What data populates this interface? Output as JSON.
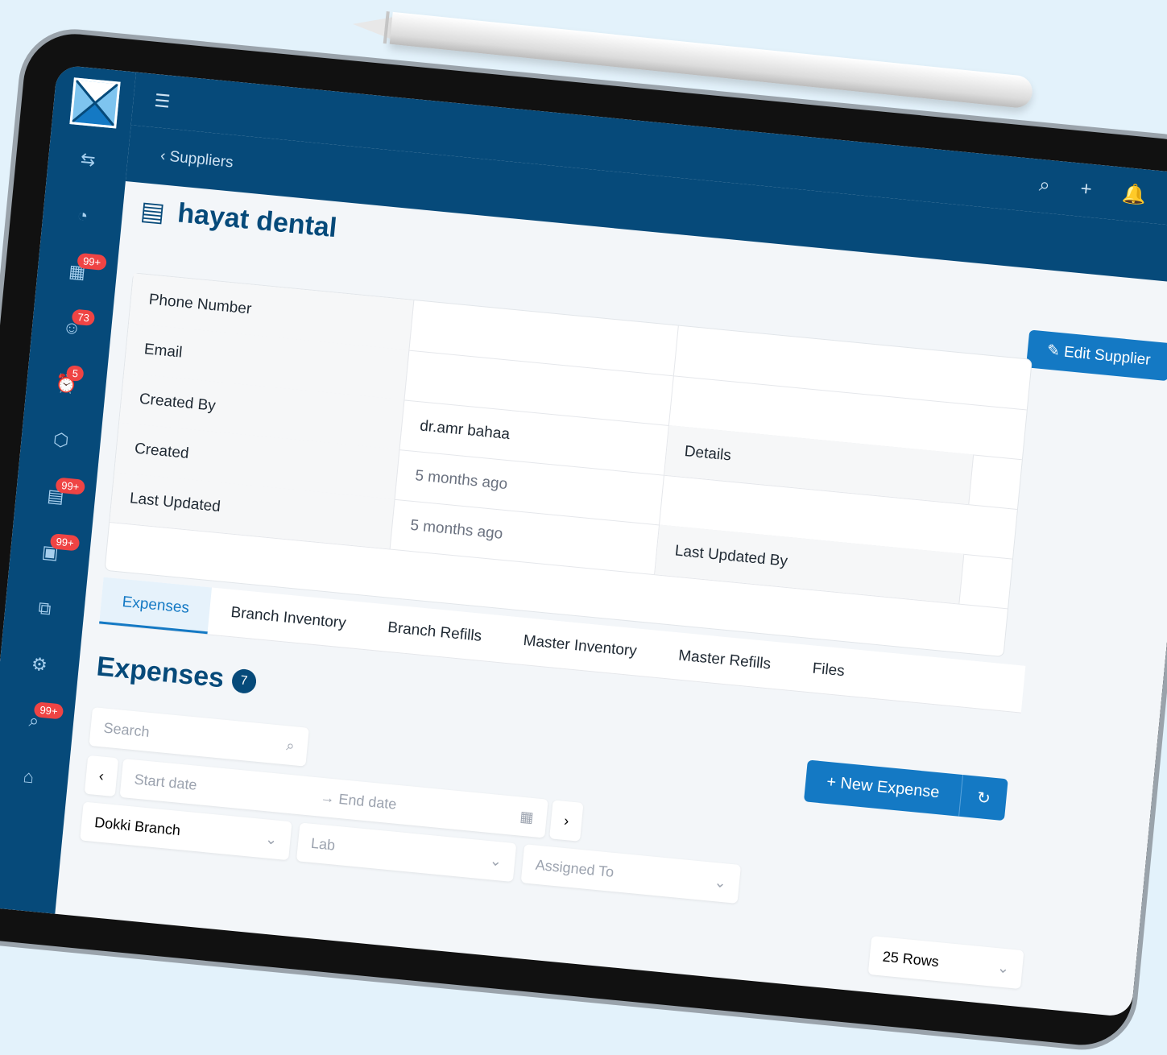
{
  "sidebar": {
    "items": [
      {
        "icon": "swap-icon"
      },
      {
        "icon": "dashboard-icon"
      },
      {
        "icon": "appointments-icon",
        "badge": "99+"
      },
      {
        "icon": "patients-icon",
        "badge": "73"
      },
      {
        "icon": "alarm-icon",
        "badge": "5"
      },
      {
        "icon": "inventory-icon"
      },
      {
        "icon": "invoice-icon",
        "badge": "99+"
      },
      {
        "icon": "payments-icon",
        "badge": "99+"
      },
      {
        "icon": "branches-icon"
      },
      {
        "icon": "settings-icon"
      },
      {
        "icon": "reports-icon",
        "badge": "99+"
      },
      {
        "icon": "bank-icon"
      }
    ]
  },
  "breadcrumb": {
    "back_label": "Suppliers"
  },
  "page": {
    "title": "hayat dental"
  },
  "edit_button": "Edit Supplier",
  "info": {
    "phone_label": "Phone Number",
    "email_label": "Email",
    "created_by_label": "Created By",
    "created_by_value": "dr.amr bahaa",
    "details_label": "Details",
    "created_label": "Created",
    "created_value": "5 months ago",
    "last_updated_label": "Last Updated",
    "last_updated_value": "5 months ago",
    "last_updated_by_label": "Last Updated By"
  },
  "tabs": [
    "Expenses",
    "Branch Inventory",
    "Branch Refills",
    "Master Inventory",
    "Master Refills",
    "Files"
  ],
  "expenses": {
    "title": "Expenses",
    "count": "7",
    "search_placeholder": "Search",
    "new_expense": "New Expense",
    "start_date": "Start date",
    "end_date": "End date",
    "branch": "Dokki Branch",
    "lab_placeholder": "Lab",
    "assigned_placeholder": "Assigned To",
    "rows": "25 Rows"
  },
  "colors": {
    "primary": "#064a7a",
    "accent": "#1479c4",
    "badge": "#ef4444"
  }
}
